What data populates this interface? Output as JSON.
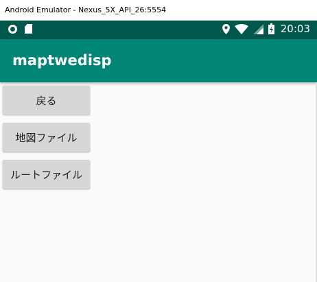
{
  "window": {
    "title": "Android Emulator - Nexus_5X_API_26:5554"
  },
  "status_bar": {
    "time": "20:03",
    "left_icons": [
      "circle-notification-icon",
      "sd-card-icon"
    ],
    "right_icons": [
      "location-icon",
      "wifi-icon",
      "signal-icon",
      "battery-charging-icon"
    ]
  },
  "app_bar": {
    "title": "maptwedisp"
  },
  "buttons": [
    {
      "label": "戻る"
    },
    {
      "label": "地図ファイル"
    },
    {
      "label": "ルートファイル"
    }
  ],
  "colors": {
    "status_bar": "#00574b",
    "app_bar": "#008577",
    "button_bg": "#d6d6d6",
    "background": "#fafafa"
  }
}
